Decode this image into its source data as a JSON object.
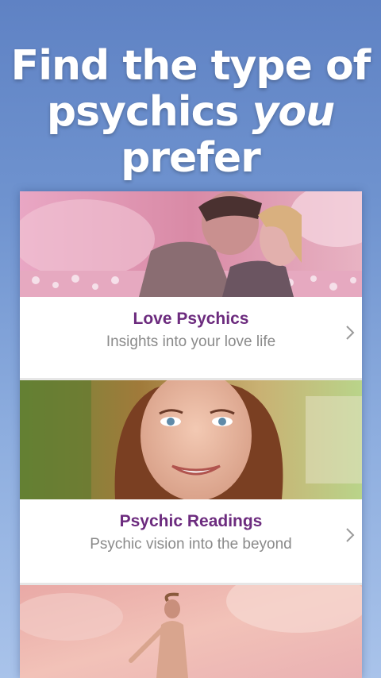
{
  "headline": {
    "line1": "Find the type of",
    "line2_start": "psychics",
    "line2_emphasis": "you",
    "line3": "prefer"
  },
  "cards": [
    {
      "title": "Love Psychics",
      "subtitle": "Insights into your love life",
      "icon": "chevron-right-icon"
    },
    {
      "title": "Psychic Readings",
      "subtitle": "Psychic vision into the beyond",
      "icon": "chevron-right-icon"
    },
    {
      "title": "",
      "subtitle": "",
      "icon": ""
    }
  ],
  "colors": {
    "title": "#6c2b7e",
    "subtitle": "#8a8a8a",
    "background_top": "#5f82c4",
    "background_bottom": "#a9c3ea"
  }
}
